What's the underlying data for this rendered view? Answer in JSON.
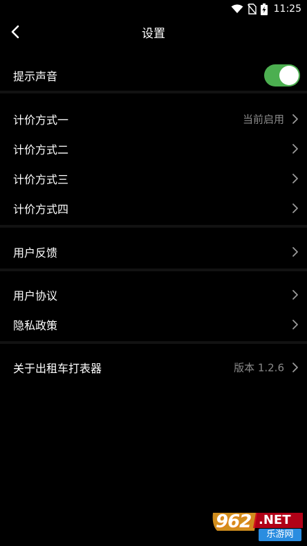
{
  "status_bar": {
    "time": "11:25",
    "icons": [
      "wifi-icon",
      "no-sim-icon",
      "battery-charging-icon"
    ]
  },
  "header": {
    "title": "设置",
    "back_icon": "chevron-left-icon"
  },
  "settings": {
    "sound": {
      "label": "提示声音",
      "enabled": true,
      "toggle_color": "#4caf50"
    },
    "pricing": [
      {
        "label": "计价方式一",
        "value": "当前启用"
      },
      {
        "label": "计价方式二",
        "value": ""
      },
      {
        "label": "计价方式三",
        "value": ""
      },
      {
        "label": "计价方式四",
        "value": ""
      }
    ],
    "feedback": {
      "label": "用户反馈"
    },
    "agreement": {
      "label": "用户协议"
    },
    "privacy": {
      "label": "隐私政策"
    },
    "about": {
      "label": "关于出租车打表器",
      "value": "版本 1.2.6"
    }
  },
  "watermark": {
    "number": "962",
    "domain": ".NET",
    "cn": "乐游网"
  }
}
